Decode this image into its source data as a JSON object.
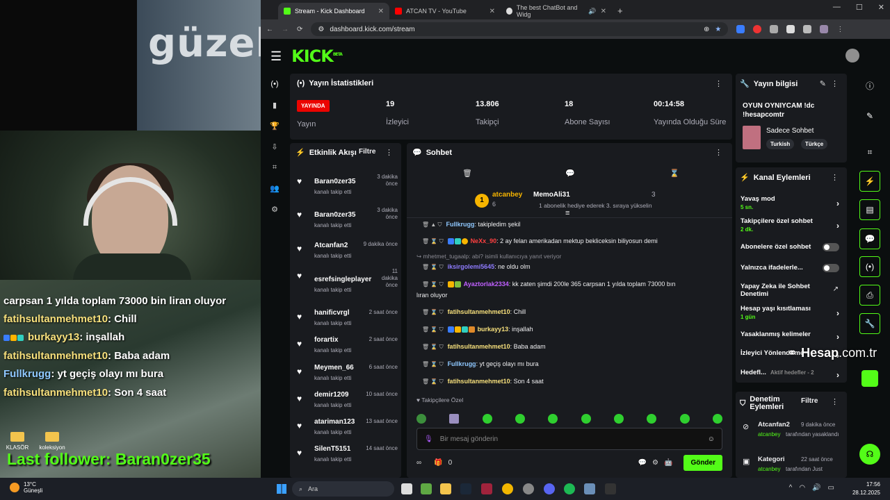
{
  "overlay": {
    "big_text": "güzel",
    "chat_lines": [
      {
        "user": "carpsan 1 yılda toplam 73000 bin liran oluyor",
        "text": ""
      },
      {
        "user": "fatihsultanmehmet10",
        "text": ": Chill"
      },
      {
        "user": "burkayy13",
        "text": ": inşallah"
      },
      {
        "user": "fatihsultanmehmet10",
        "text": ": Baba adam"
      },
      {
        "user": "Fullkrugg",
        "text": ": yt geçiş olayı mı bura"
      },
      {
        "user": "fatihsultanmehmet10",
        "text": ": Son 4 saat"
      }
    ],
    "last_follower": "Last follower: Baran0zer35",
    "desktop_icons": [
      "KLASÖR",
      "koleksiyon"
    ]
  },
  "browser": {
    "tabs": [
      {
        "title": "Stream - Kick Dashboard",
        "color": "#53fc18"
      },
      {
        "title": "ATCAN TV - YouTube",
        "color": "#ff0000"
      },
      {
        "title": "The best ChatBot and Widg",
        "color": "#dddddd"
      }
    ],
    "new_tab": "+",
    "url": "dashboard.kick.com/stream"
  },
  "kick": {
    "logo": "KICK",
    "logo_sup": "BETA",
    "stats": {
      "title": "Yayın İstatistikleri",
      "live_badge": "YAYINDA",
      "live_label": "Yayın",
      "items": [
        {
          "value": "19",
          "label": "İzleyici"
        },
        {
          "value": "13.806",
          "label": "Takipçi"
        },
        {
          "value": "18",
          "label": "Abone Sayısı"
        },
        {
          "value": "00:14:58",
          "label": "Yayında Olduğu Süre"
        }
      ]
    },
    "activity": {
      "title": "Etkinlik Akışı",
      "filter": "Filtre",
      "items": [
        {
          "name": "Baran0zer35",
          "time": "3 dakika önce",
          "desc": "kanalı takip etti"
        },
        {
          "name": "Baran0zer35",
          "time": "3 dakika önce",
          "desc": "kanalı takip etti"
        },
        {
          "name": "Atcanfan2",
          "time": "9 dakika önce",
          "desc": "kanalı takip etti"
        },
        {
          "name": "esrefsingleplayer",
          "time": "11 dakika önce",
          "desc": "kanalı takip etti"
        },
        {
          "name": "hanificvrgl",
          "time": "2 saat önce",
          "desc": "kanalı takip etti"
        },
        {
          "name": "forartix",
          "time": "2 saat önce",
          "desc": "kanalı takip etti"
        },
        {
          "name": "Meymen_66",
          "time": "6 saat önce",
          "desc": "kanalı takip etti"
        },
        {
          "name": "demir1209",
          "time": "10 saat önce",
          "desc": "kanalı takip etti"
        },
        {
          "name": "atariman123",
          "time": "13 saat önce",
          "desc": "kanalı takip etti"
        },
        {
          "name": "SilenT5151",
          "time": "14 saat önce",
          "desc": "kanalı takip etti"
        }
      ]
    },
    "chat": {
      "title": "Sohbet",
      "pinned": {
        "rank": "1",
        "user1": "atcanbey",
        "user1_count": "6",
        "user2": "MemoAli31",
        "user2_count": "3",
        "message": "1 abonelik hediye ederek 3. sıraya yükselin"
      },
      "messages": [
        {
          "user": "Fullkrugg",
          "text": ": takipledim şekil",
          "color": "#8fc8ff"
        },
        {
          "user": "NeXx_90",
          "text": ": 2 ay felan amerikadan mektup bekliceksin biliyosun demi",
          "color": "#ff4040"
        },
        {
          "reply": "mhetmet_tugaalp: abi? isimli kullanıcıya yanıt veriyor"
        },
        {
          "user": "iksirgolemi5645",
          "text": ": ne oldu olm",
          "color": "#8f7cff"
        },
        {
          "user": "Ayaztorlak2334",
          "text": ": kk zaten şimdi 200le 365 carpsan 1 yılda toplam 73000 bın",
          "color": "#c060ff",
          "cont": "lıran oluyor"
        },
        {
          "user": "fatihsultanmehmet10",
          "text": ": Chill",
          "color": "#f7e07c"
        },
        {
          "user": "burkayy13",
          "text": ": inşallah",
          "color": "#f7e07c"
        },
        {
          "user": "fatihsultanmehmet10",
          "text": ": Baba adam",
          "color": "#f7e07c"
        },
        {
          "user": "Fullkrugg",
          "text": ": yt geçiş olayı mı bura",
          "color": "#8fc8ff"
        },
        {
          "user": "fatihsultanmehmet10",
          "text": ": Son 4 saat",
          "color": "#f7e07c"
        }
      ],
      "followers_only": "Takipçilere Özel",
      "input_placeholder": "Bir mesaj gönderin",
      "points": "0",
      "send": "Gönder"
    },
    "info": {
      "title": "Yayın bilgisi",
      "stream_title": "OYUN OYNIYCAM !dc !hesapcomtr",
      "category": "Sadece Sohbet",
      "tags": [
        "Turkish",
        "Türkçe"
      ]
    },
    "channel": {
      "title": "Kanal Eylemleri",
      "items": [
        {
          "label": "Yavaş mod",
          "sub": "5 sn.",
          "control": "arrow"
        },
        {
          "label": "Takipçilere özel sohbet",
          "sub": "2 dk.",
          "control": "arrow"
        },
        {
          "label": "Abonelere özel sohbet",
          "sub": "",
          "control": "toggle"
        },
        {
          "label": "Yalnızca ifadelerle...",
          "sub": "",
          "control": "toggle"
        },
        {
          "label": "Yapay Zeka ile Sohbet Denetimi",
          "sub": "",
          "control": "external"
        },
        {
          "label": "Hesap yaşı kısıtlaması",
          "sub": "1 gün",
          "control": "arrow"
        },
        {
          "label": "Yasaklanmış kelimeler",
          "sub": "",
          "control": "arrow"
        },
        {
          "label": "İzleyici Yönlendirme",
          "sub": "",
          "control": "arrow"
        },
        {
          "label": "Hedefl...",
          "sub": "Aktif hedefler - 2",
          "control": "arrow"
        }
      ]
    },
    "moderation": {
      "title": "Denetim Eylemleri",
      "filter": "Filtre",
      "items": [
        {
          "user": "Atcanfan2",
          "time": "9 dakika önce",
          "by": "atcanbey",
          "desc": "tarafından yasaklandı"
        },
        {
          "user": "Kategori",
          "time": "22 saat önce",
          "by": "atcanbey",
          "desc": "tarafından Just"
        }
      ]
    }
  },
  "watermark": {
    "brand": "Hesap",
    "suffix": ".com.tr"
  },
  "taskbar": {
    "temp": "13°C",
    "weather": "Güneşli",
    "search": "Ara",
    "time": "17:56",
    "date": "28.12.2025"
  }
}
